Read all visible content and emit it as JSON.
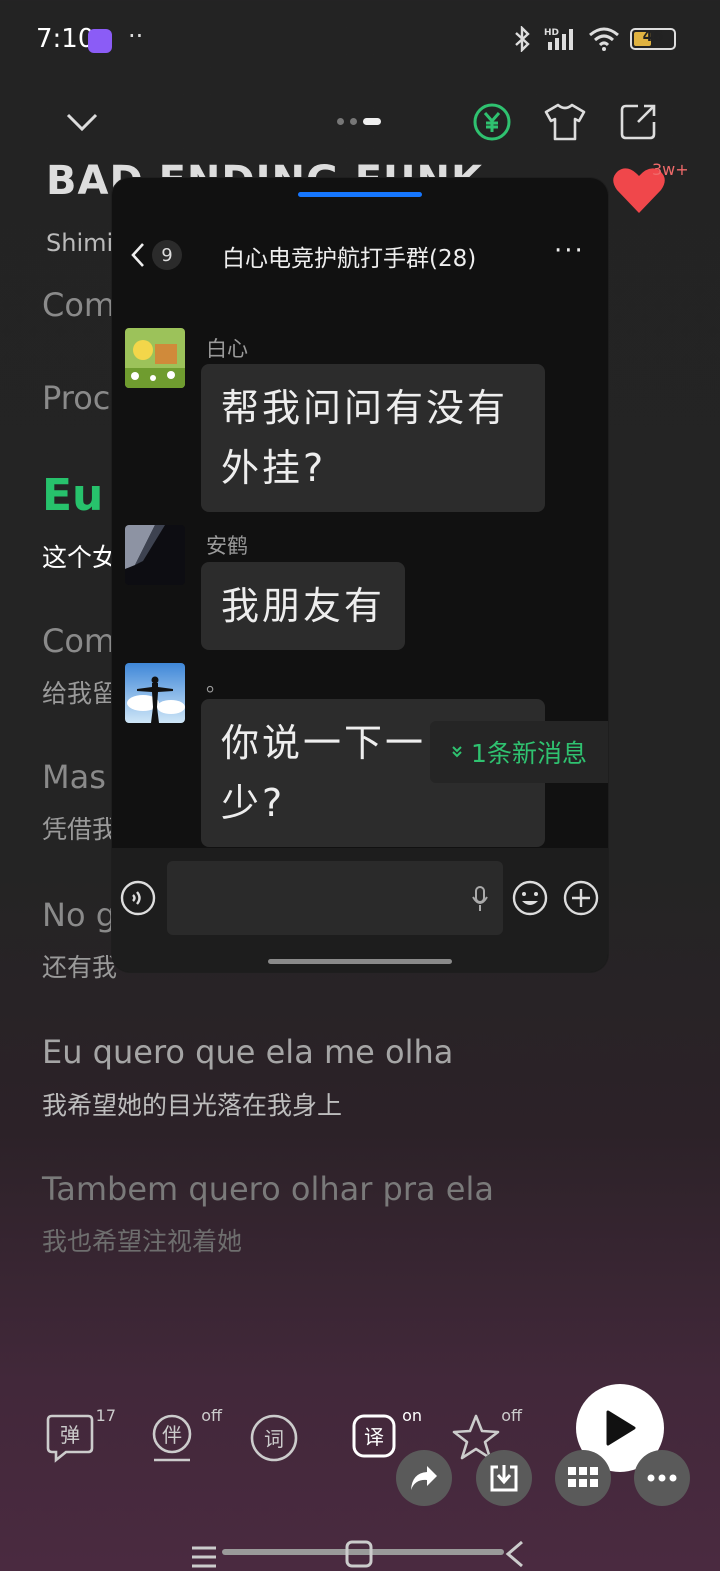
{
  "status": {
    "time": "7:10",
    "dots": "··",
    "battery": "46"
  },
  "song": {
    "title": "BAD ENDING FUNK",
    "artist": "Shimi",
    "likes": "3w+"
  },
  "lyrics": [
    {
      "pt": "Com",
      "cn": ""
    },
    {
      "pt": "Proc",
      "cn": ""
    },
    {
      "pt": "Eu",
      "cn": "这个女"
    },
    {
      "pt": "Com",
      "cn": "给我留"
    },
    {
      "pt": "Mas",
      "cn": "凭借我"
    },
    {
      "pt": "No g",
      "cn": "还有我"
    },
    {
      "pt": "Eu quero que ela me olha",
      "cn": "我希望她的目光落在我身上"
    },
    {
      "pt": "Tambem quero olhar pra ela",
      "cn": "我也希望注视着她"
    }
  ],
  "controls": {
    "danmu": {
      "label": "弹",
      "badge": "17"
    },
    "accompany": {
      "label": "伴",
      "badge": "off"
    },
    "lyric": {
      "label": "词"
    },
    "translate": {
      "label": "译",
      "badge": "on"
    },
    "star": {
      "badge": "off"
    }
  },
  "chat": {
    "back_count": "9",
    "title": "白心电竞护航打手群(28)",
    "messages": [
      {
        "name": "白心",
        "text_l1": "帮我问问有没有",
        "text_l2": "外挂?"
      },
      {
        "name": "安鹤",
        "text_l1": "我朋友有"
      },
      {
        "name": "。",
        "text_l1": "你说一下一",
        "text_l2": "少?"
      }
    ],
    "new_message_tip": "1条新消息",
    "more": "···"
  }
}
